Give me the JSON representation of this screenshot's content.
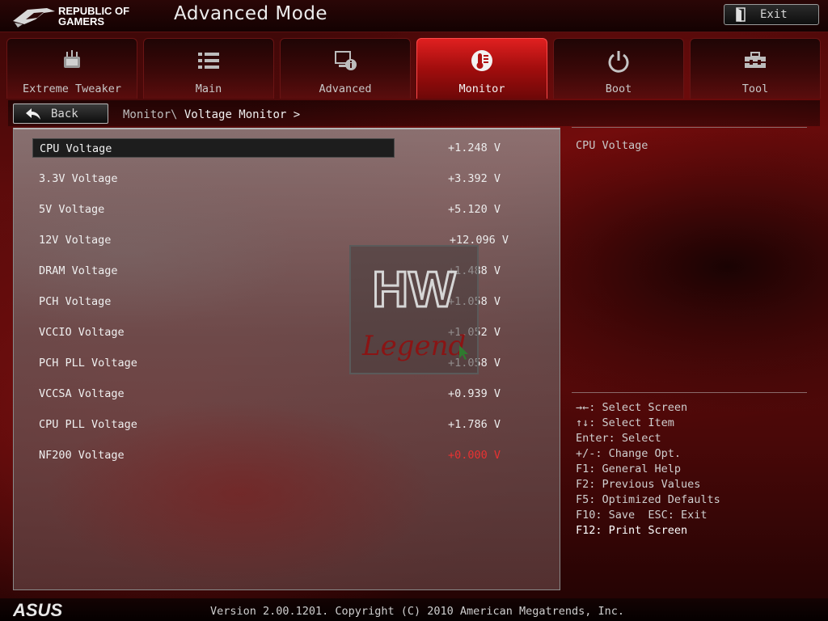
{
  "header": {
    "brand_line1": "REPUBLIC OF",
    "brand_line2": "GAMERS",
    "title": "Advanced Mode",
    "exit_label": "Exit"
  },
  "tabs": [
    {
      "label": "Extreme Tweaker",
      "icon": "tweaker-gauge-icon",
      "active": false
    },
    {
      "label": "Main",
      "icon": "list-icon",
      "active": false
    },
    {
      "label": "Advanced",
      "icon": "advanced-info-icon",
      "active": false
    },
    {
      "label": "Monitor",
      "icon": "thermometer-icon",
      "active": true
    },
    {
      "label": "Boot",
      "icon": "power-icon",
      "active": false
    },
    {
      "label": "Tool",
      "icon": "toolbox-icon",
      "active": false
    }
  ],
  "nav": {
    "back_label": "Back",
    "breadcrumb_parent": "Monitor\\",
    "breadcrumb_current": "Voltage Monitor >"
  },
  "voltages": [
    {
      "name": "CPU Voltage",
      "value": "+1.248 V",
      "selected": true
    },
    {
      "name": "3.3V Voltage",
      "value": "+3.392 V"
    },
    {
      "name": "5V Voltage",
      "value": "+5.120 V"
    },
    {
      "name": "12V Voltage",
      "value": "+12.096 V"
    },
    {
      "name": "DRAM Voltage",
      "value": "+1.488 V"
    },
    {
      "name": "PCH Voltage",
      "value": "+1.058 V"
    },
    {
      "name": "VCCIO Voltage",
      "value": "+1.052 V"
    },
    {
      "name": "PCH PLL Voltage",
      "value": "+1.058 V"
    },
    {
      "name": "VCCSA Voltage",
      "value": "+0.939 V"
    },
    {
      "name": "CPU PLL Voltage",
      "value": "+1.786 V"
    },
    {
      "name": "NF200 Voltage",
      "value": "+0.000 V",
      "alert": true
    }
  ],
  "help": {
    "title": "CPU Voltage",
    "keys": [
      "→←: Select Screen",
      "↑↓: Select Item",
      "Enter: Select",
      "+/-: Change Opt.",
      "F1: General Help",
      "F2: Previous Values",
      "F5: Optimized Defaults",
      "F10: Save  ESC: Exit",
      "F12: Print Screen"
    ]
  },
  "watermark": {
    "line1": "HW",
    "line2": "Legend"
  },
  "footer": {
    "brand": "ASUS",
    "version": "Version 2.00.1201. Copyright (C) 2010 American Megatrends, Inc."
  },
  "colors": {
    "accent_red": "#e02020",
    "alert_value": "#e83232",
    "selected_row": "#1d1d1d"
  }
}
